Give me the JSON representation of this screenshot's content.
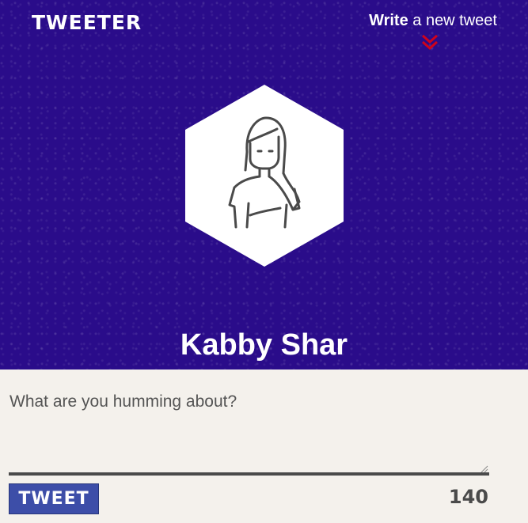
{
  "header": {
    "brand": "TWEETER",
    "write_link": {
      "bold": "Write",
      "rest": " a new tweet"
    },
    "chevron_icon": "double-chevron-down-icon",
    "colors": {
      "background": "#2a0c8a",
      "chevron": "#d0021b"
    }
  },
  "profile": {
    "avatar_icon": "person-avatar-icon",
    "name": "Kabby Shar"
  },
  "compose": {
    "placeholder": "What are you humming about?",
    "button_label": "TWEET",
    "counter": "140",
    "colors": {
      "button": "#3d4ea8",
      "background": "#f4f1ec"
    }
  }
}
